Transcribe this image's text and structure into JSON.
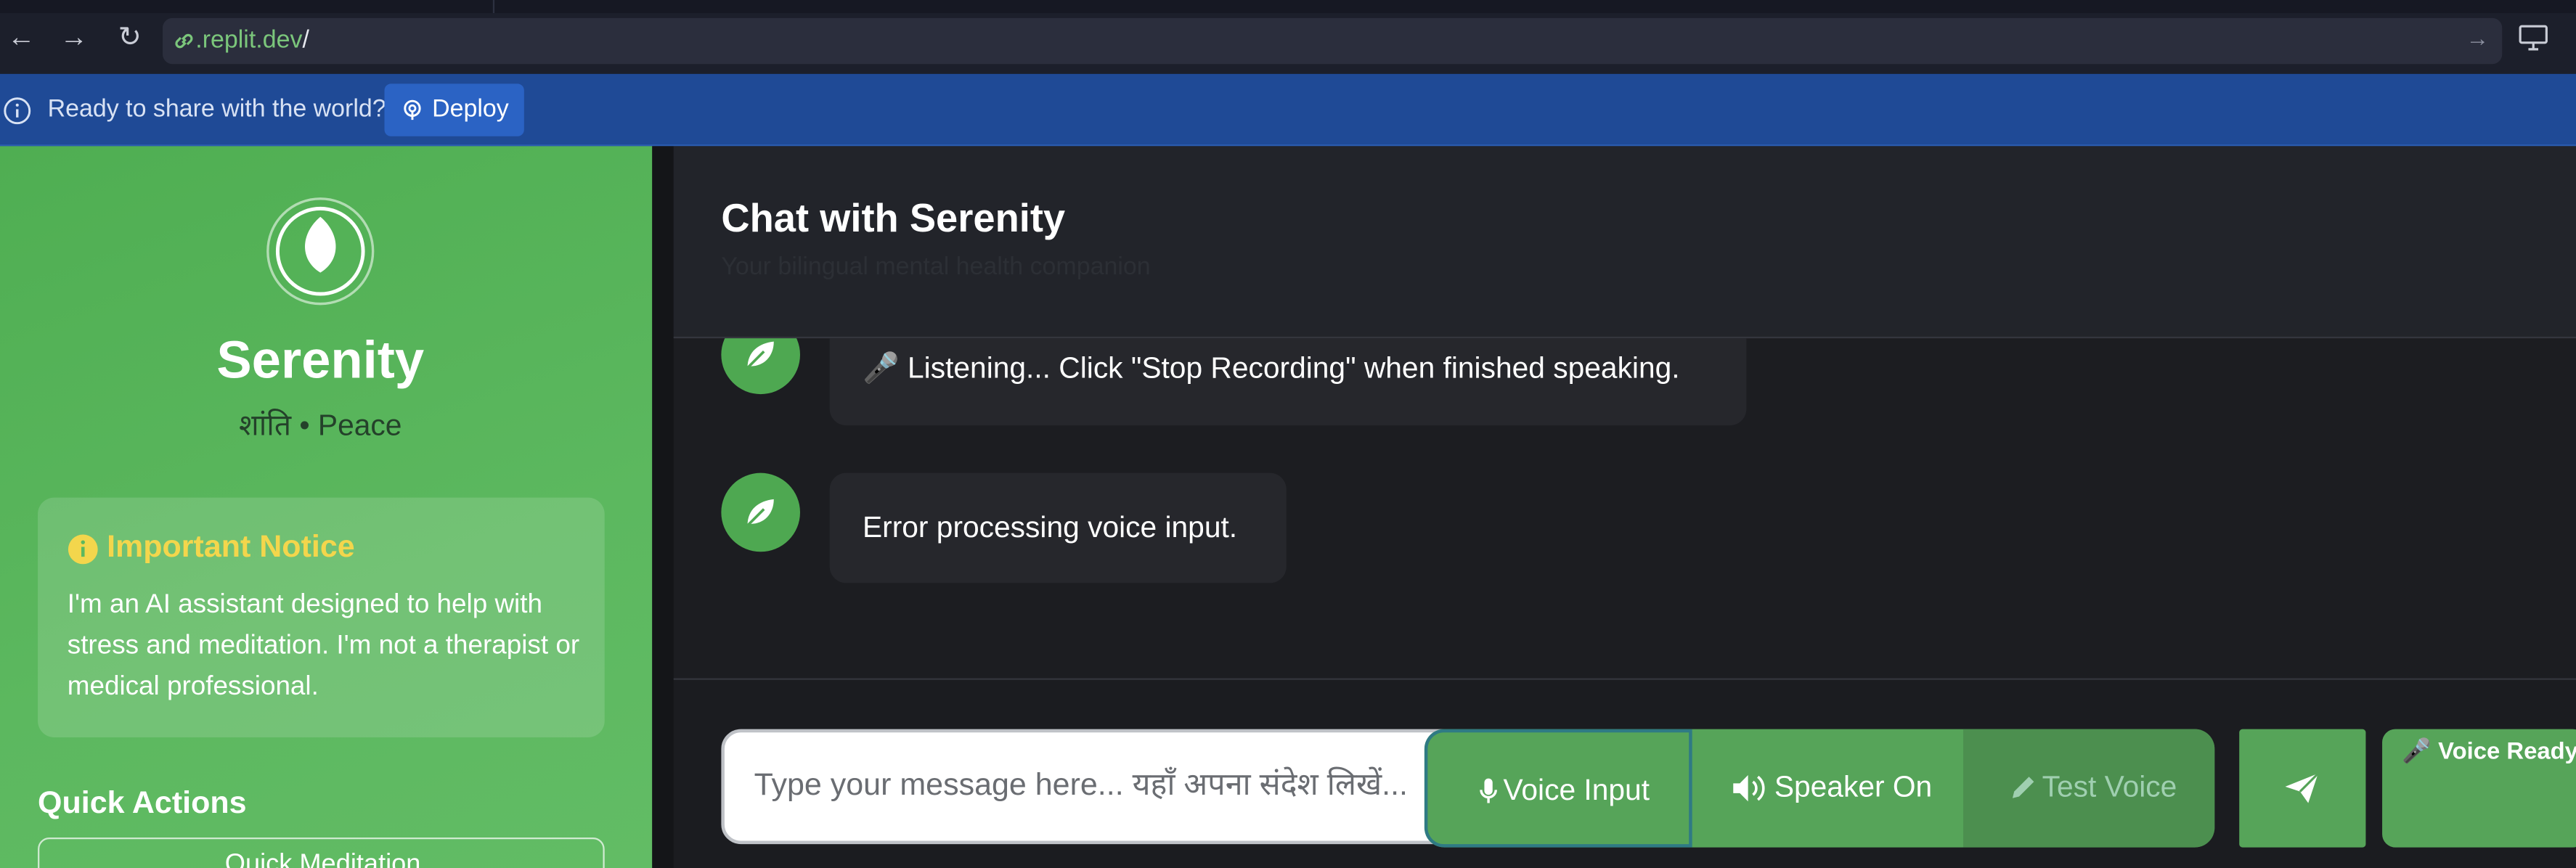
{
  "browser": {
    "url_host": ".replit.dev",
    "url_path": "/",
    "back_glyph": "←",
    "forward_glyph": "→",
    "reload_glyph": "↻",
    "go_glyph": "→"
  },
  "banner": {
    "message": "Ready to share with the world?",
    "deploy_label": "Deploy"
  },
  "sidebar": {
    "title": "Serenity",
    "subtitle": "शांति • Peace",
    "notice": {
      "title": "Important Notice",
      "body": "I'm an AI assistant designed to help with stress and meditation. I'm not a therapist or medical professional."
    },
    "quick_actions_title": "Quick Actions",
    "quick_actions": [
      {
        "label": "Quick Meditation"
      }
    ]
  },
  "chat": {
    "title": "Chat with Serenity",
    "subtitle": "Your bilingual mental health companion",
    "messages": [
      {
        "sender": "bot",
        "text": "🎤 Listening... Click \"Stop Recording\" when finished speaking."
      },
      {
        "sender": "bot",
        "text": "Error processing voice input."
      }
    ],
    "input_placeholder": "Type your message here... यहाँ अपना संदेश लिखें...",
    "buttons": {
      "voice_input": "Voice Input",
      "speaker": "Speaker On",
      "test_voice": "Test Voice"
    },
    "voice_status": "🎤 Voice Ready"
  },
  "colors": {
    "sidebar_green": "#5cb85f",
    "accent_green": "#56a459",
    "banner_blue": "#1f4a96",
    "notice_title_yellow": "#f3d64c",
    "chat_bg": "#1c1d21"
  }
}
